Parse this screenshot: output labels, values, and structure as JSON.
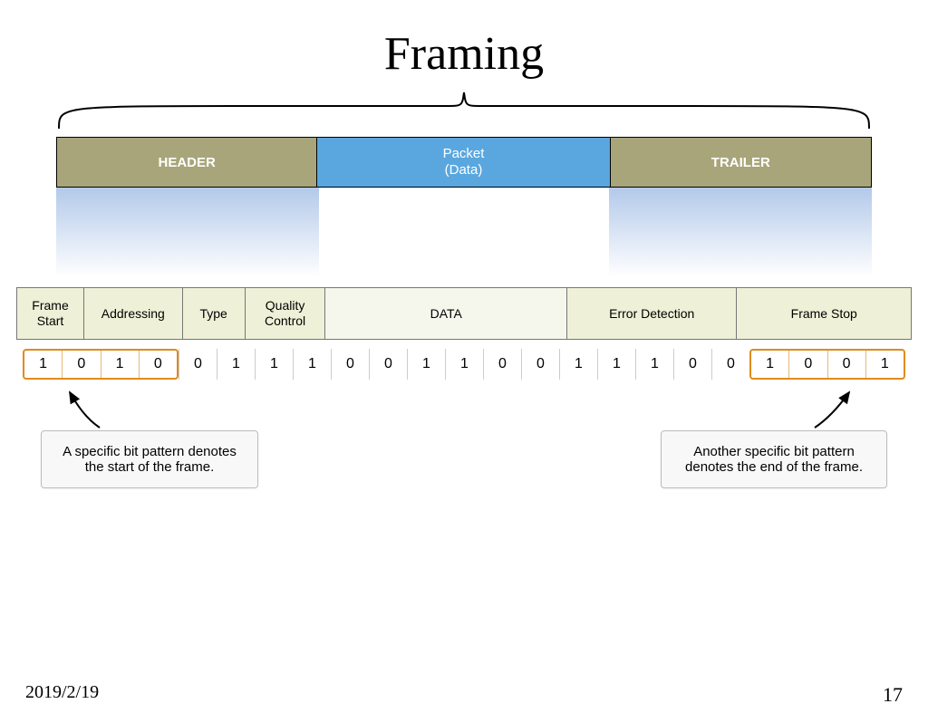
{
  "title": "Framing",
  "top_segments": {
    "header": "HEADER",
    "packet_line1": "Packet",
    "packet_line2": "(Data)",
    "trailer": "TRAILER"
  },
  "detail_segments": {
    "frame_start": "Frame Start",
    "addressing": "Addressing",
    "type": "Type",
    "quality_control": "Quality Control",
    "data": "DATA",
    "error_detection": "Error Detection",
    "frame_stop": "Frame Stop"
  },
  "bit_stream": {
    "start_flag": [
      "1",
      "0",
      "1",
      "0"
    ],
    "middle": [
      "0",
      "1",
      "1",
      "1",
      "0",
      "0",
      "1",
      "1",
      "0",
      "0",
      "1",
      "1",
      "1",
      "0",
      "0"
    ],
    "end_flag": [
      "1",
      "0",
      "0",
      "1"
    ]
  },
  "callouts": {
    "start": "A specific bit pattern denotes the start of the frame.",
    "end": "Another specific bit pattern denotes the end of the frame."
  },
  "footer": {
    "date": "2019/2/19",
    "page": "17"
  }
}
